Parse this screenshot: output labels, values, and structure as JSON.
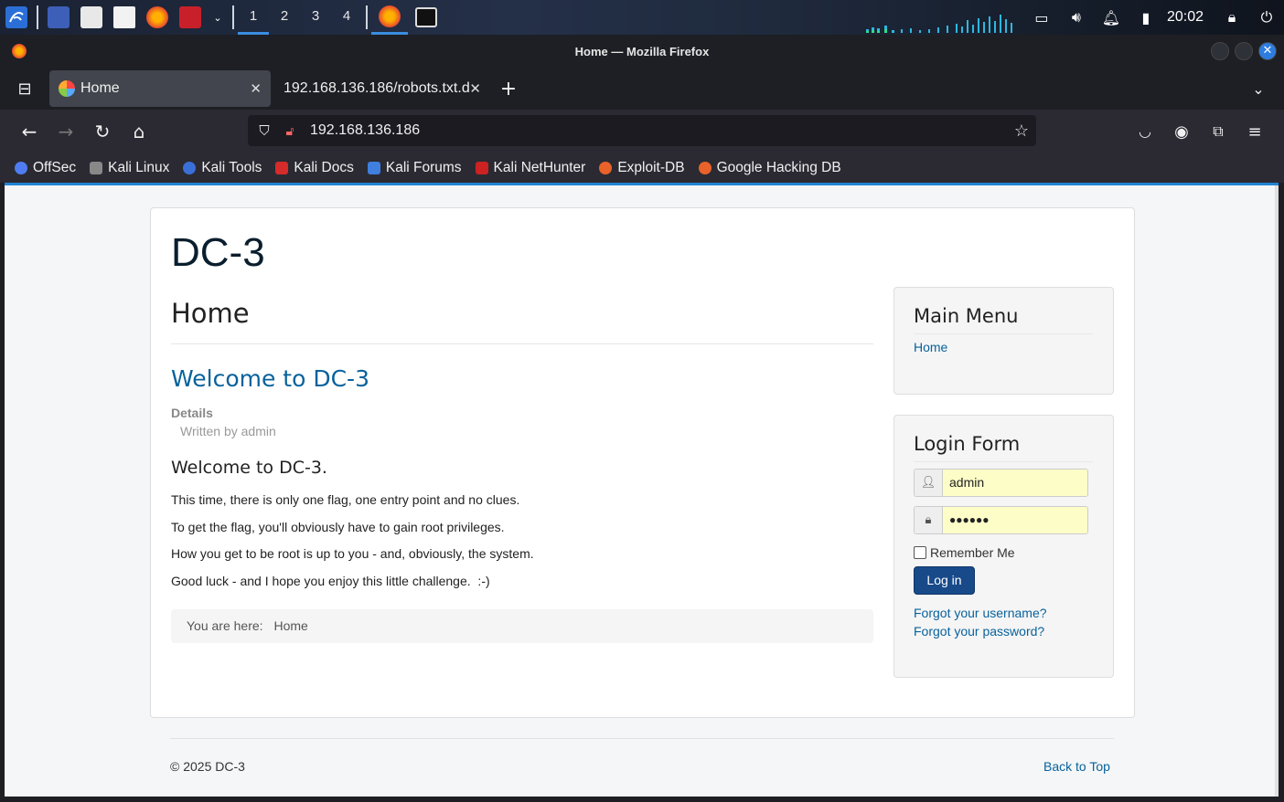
{
  "taskbar": {
    "workspaces": [
      "1",
      "2",
      "3",
      "4"
    ],
    "clock": "20:02"
  },
  "window": {
    "title": "Home — Mozilla Firefox"
  },
  "tabs": [
    {
      "label": "Home"
    },
    {
      "label": "192.168.136.186/robots.txt.d"
    }
  ],
  "urlbar": {
    "url": "192.168.136.186"
  },
  "bookmarks": [
    "OffSec",
    "Kali Linux",
    "Kali Tools",
    "Kali Docs",
    "Kali Forums",
    "Kali NetHunter",
    "Exploit-DB",
    "Google Hacking DB"
  ],
  "page": {
    "site_title": "DC-3",
    "heading": "Home",
    "article_title": "Welcome to DC-3",
    "details_label": "Details",
    "written_by": "Written by admin",
    "article_subheading": "Welcome to DC-3.",
    "paragraphs": [
      "This time, there is only one flag, one entry point and no clues.",
      "To get the flag, you'll obviously have to gain root privileges.",
      "How you get to be root is up to you - and, obviously, the system.",
      "Good luck - and I hope you enjoy this little challenge.  :-)"
    ],
    "breadcrumb_prefix": "You are here:",
    "breadcrumb_current": "Home"
  },
  "main_menu": {
    "title": "Main Menu",
    "items": [
      "Home"
    ]
  },
  "login_form": {
    "title": "Login Form",
    "username": "admin",
    "password_mask": "●●●●●●",
    "remember_label": "Remember Me",
    "login_button": "Log in",
    "forgot_username": "Forgot your username?",
    "forgot_password": "Forgot your password?"
  },
  "footer": {
    "copyright": "© 2025 DC-3",
    "back_to_top": "Back to Top"
  },
  "colors": {
    "accent": "#1f85d5",
    "link": "#08629c",
    "button": "#184a8a"
  }
}
